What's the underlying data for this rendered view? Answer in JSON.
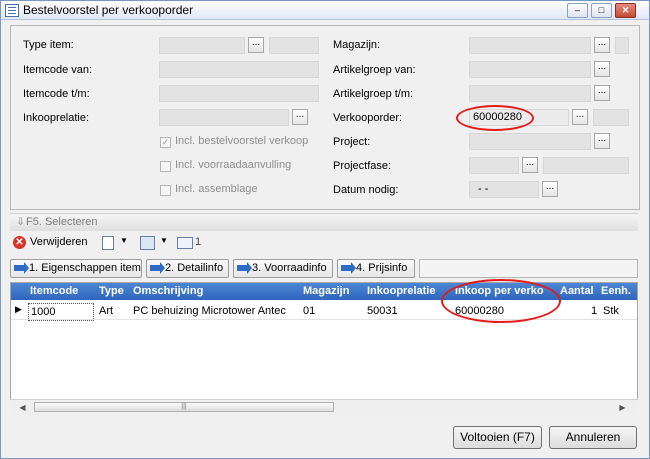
{
  "window": {
    "title": "Bestelvoorstel per verkooporder"
  },
  "form": {
    "left": {
      "type_item_label": "Type item:",
      "itemcode_van_label": "Itemcode van:",
      "itemcode_tm_label": "Itemcode t/m:",
      "inkooprelatie_label": "Inkooprelatie:",
      "chk_bestelvoorstel": "Incl. bestelvoorstel verkoop",
      "chk_voorraadaanvulling": "Incl. voorraadaanvulling",
      "chk_assemblage": "Incl. assemblage",
      "chk_bestelvoorstel_checked": true,
      "chk_voorraadaanvulling_checked": false,
      "chk_assemblage_checked": false
    },
    "right": {
      "magazijn_label": "Magazijn:",
      "artikelgroep_van_label": "Artikelgroep van:",
      "artikelgroep_tm_label": "Artikelgroep t/m:",
      "verkooporder_label": "Verkooporder:",
      "verkooporder_value": "60000280",
      "project_label": "Project:",
      "projectfase_label": "Projectfase:",
      "datum_nodig_label": "Datum nodig:",
      "datum_nodig_value": "- -"
    },
    "browse_label": "..."
  },
  "section": {
    "label": "F5. Selecteren"
  },
  "toolbar": {
    "verwijderen_label": "Verwijderen",
    "count_label": "1"
  },
  "tabs": [
    {
      "label": "1. Eigenschappen item"
    },
    {
      "label": "2. Detailinfo"
    },
    {
      "label": "3. Voorraadinfo"
    },
    {
      "label": "4. Prijsinfo"
    }
  ],
  "grid": {
    "columns": [
      "Itemcode",
      "Type",
      "Omschrijving",
      "Magazijn",
      "Inkooprelatie",
      "Inkoop per verko",
      "Aantal",
      "Eenh."
    ],
    "rows": [
      [
        "1000",
        "Art",
        "PC behuizing Microtower Antec",
        "01",
        "50031",
        "60000280",
        "1",
        "Stk"
      ]
    ]
  },
  "buttons": {
    "voltooien": "Voltooien (F7)",
    "annuleren": "Annuleren"
  },
  "colors": {
    "highlight_circle": "#e21b1b",
    "grid_header": "#3a72c8"
  }
}
